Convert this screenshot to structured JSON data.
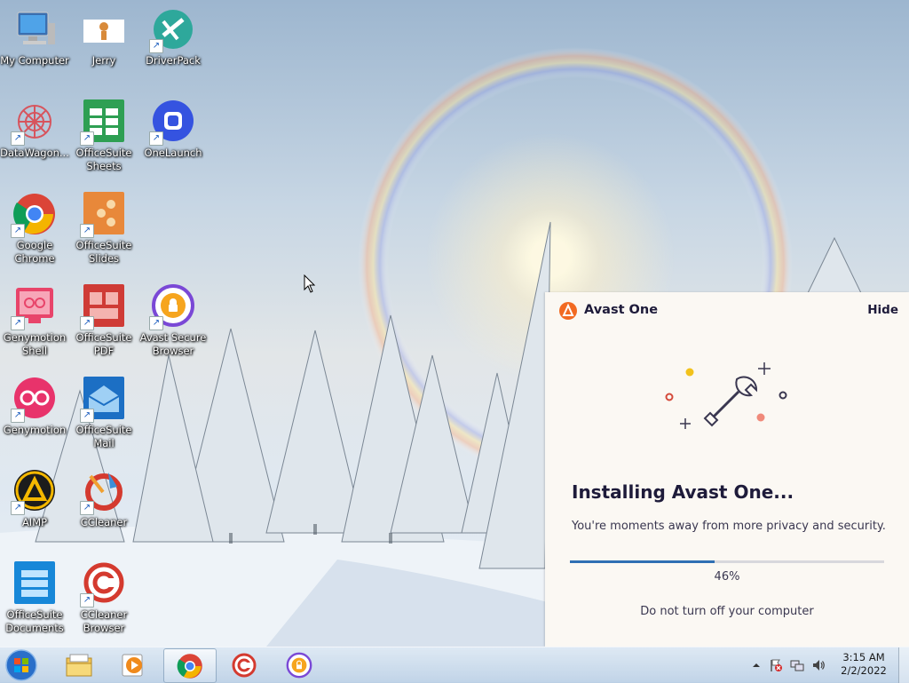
{
  "desktop": {
    "icons": [
      {
        "label": "My Computer",
        "icon": "computer-icon"
      },
      {
        "label": "Jerry",
        "icon": "jerry-icon"
      },
      {
        "label": "DriverPack",
        "icon": "driverpack-icon"
      },
      {
        "label": "DataWagon...",
        "icon": "datawagon-icon"
      },
      {
        "label": "OfficeSuite\nSheets",
        "icon": "sheets-icon"
      },
      {
        "label": "OneLaunch",
        "icon": "onelaunch-icon"
      },
      {
        "label": "Google\nChrome",
        "icon": "chrome-icon"
      },
      {
        "label": "OfficeSuite\nSlides",
        "icon": "slides-icon"
      },
      {
        "label": "Genymotion\nShell",
        "icon": "genymotion-shell-icon"
      },
      {
        "label": "OfficeSuite\nPDF",
        "icon": "pdf-icon"
      },
      {
        "label": "Avast Secure\nBrowser",
        "icon": "avast-browser-icon"
      },
      {
        "label": "Genymotion",
        "icon": "genymotion-icon"
      },
      {
        "label": "OfficeSuite\nMail",
        "icon": "mail-icon"
      },
      {
        "label": "AIMP",
        "icon": "aimp-icon"
      },
      {
        "label": "CCleaner",
        "icon": "ccleaner-icon"
      },
      {
        "label": "OfficeSuite\nDocuments",
        "icon": "documents-icon"
      },
      {
        "label": "CCleaner\nBrowser",
        "icon": "ccleaner-browser-icon"
      }
    ]
  },
  "avast": {
    "title": "Avast One",
    "hide_label": "Hide",
    "heading": "Installing Avast One...",
    "subtitle": "You're moments away from more privacy and security.",
    "progress_value": 0.46,
    "progress_text": "46%",
    "warning": "Do not turn off your computer",
    "colors": {
      "brand": "#f26a22",
      "progress": "#2f6fb3",
      "text": "#1e1b3a"
    }
  },
  "taskbar": {
    "pinned": [
      {
        "icon": "windows-explorer-icon"
      },
      {
        "icon": "media-player-icon"
      },
      {
        "icon": "chrome-icon",
        "active": true
      },
      {
        "icon": "ccleaner-browser-icon"
      },
      {
        "icon": "avast-secure-browser-icon"
      }
    ],
    "tray_icons": [
      "show-hidden-icons-icon",
      "action-center-flag-icon",
      "network-icon",
      "volume-icon"
    ],
    "clock": {
      "time": "3:15 AM",
      "date": "2/2/2022"
    }
  }
}
